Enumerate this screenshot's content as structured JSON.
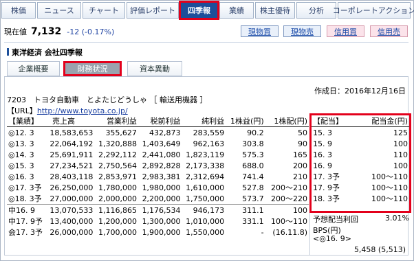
{
  "tabs": [
    {
      "label": "株価",
      "active": false
    },
    {
      "label": "ニュース",
      "active": false
    },
    {
      "label": "チャート",
      "active": false
    },
    {
      "label": "評価レポート",
      "active": false
    },
    {
      "label": "四季報",
      "active": true
    },
    {
      "label": "業績",
      "active": false
    },
    {
      "label": "株主優待",
      "active": false
    },
    {
      "label": "分析",
      "active": false
    },
    {
      "label": "コーポレートアクション",
      "active": false
    }
  ],
  "price": {
    "label": "現在値",
    "value": "7,132",
    "change": "-12 (-0.17%)"
  },
  "trade_buttons": {
    "cash_buy": "現物買",
    "cash_sell": "現物売",
    "margin_buy": "信用買",
    "margin_sell": "信用売"
  },
  "company_header": "東洋経済 会社四季報",
  "subtabs": [
    {
      "label": "企業概要",
      "active": false
    },
    {
      "label": "財務状況",
      "active": true
    },
    {
      "label": "資本異動",
      "active": false
    }
  ],
  "created": "作成日：2016年12月16日",
  "stock_line": "7203　トヨタ自動車　とよたじどうしゃ ［ 輸送用機器 ］",
  "url_label": "【URL】",
  "url": "http://www.toyota.co.jp/",
  "gyoseki": {
    "headers": [
      "【業績】",
      "売上高",
      "営業利益",
      "税前利益",
      "純利益",
      "1株益(円)",
      "1株配(円)"
    ],
    "rows": [
      [
        "◎12. 3",
        "18,583,653",
        "355,627",
        "432,873",
        "283,559",
        "90.2",
        "50"
      ],
      [
        "◎13. 3",
        "22,064,192",
        "1,320,888",
        "1,403,649",
        "962,163",
        "303.8",
        "90"
      ],
      [
        "◎14. 3",
        "25,691,911",
        "2,292,112",
        "2,441,080",
        "1,823,119",
        "575.3",
        "165"
      ],
      [
        "◎15. 3",
        "27,234,521",
        "2,750,564",
        "2,892,828",
        "2,173,338",
        "688.0",
        "200"
      ],
      [
        "◎16. 3",
        "28,403,118",
        "2,853,971",
        "2,983,381",
        "2,312,694",
        "741.4",
        "210"
      ],
      [
        "◎17. 3予",
        "26,250,000",
        "1,780,000",
        "1,980,000",
        "1,610,000",
        "527.8",
        "200～210"
      ],
      [
        "◎18. 3予",
        "27,000,000",
        "2,000,000",
        "2,200,000",
        "1,750,000",
        "573.7",
        "200～220"
      ],
      [
        "中16. 9",
        "13,070,533",
        "1,116,865",
        "1,176,534",
        "946,173",
        "311.1",
        "100"
      ],
      [
        "中17. 9予",
        "13,400,000",
        "1,200,000",
        "1,300,000",
        "1,010,000",
        "331.1",
        "100～110"
      ],
      [
        "会17. 3予",
        "26,000,000",
        "1,700,000",
        "1,900,000",
        "1,550,000",
        "-",
        "(16.11.8)"
      ]
    ]
  },
  "dividend": {
    "headers": [
      "【配当】",
      "配当金(円)"
    ],
    "rows": [
      [
        "15. 3",
        "125"
      ],
      [
        "15. 9",
        "100"
      ],
      [
        "16. 3",
        "110"
      ],
      [
        "16. 9",
        "100"
      ],
      [
        "17. 3予",
        "100～110"
      ],
      [
        "17. 9予",
        "100～110"
      ],
      [
        "18. 3予",
        "100～110"
      ]
    ]
  },
  "yield": {
    "label": "予想配当利回",
    "value": "3.01%"
  },
  "bps": {
    "label": "BPS(円)",
    "period": "<◎16. 9>",
    "value": "5,458 (5,513)"
  },
  "colors": {
    "accent": "#1d4f9a",
    "highlight": "#e3001b",
    "link": "#1a3fa0"
  }
}
